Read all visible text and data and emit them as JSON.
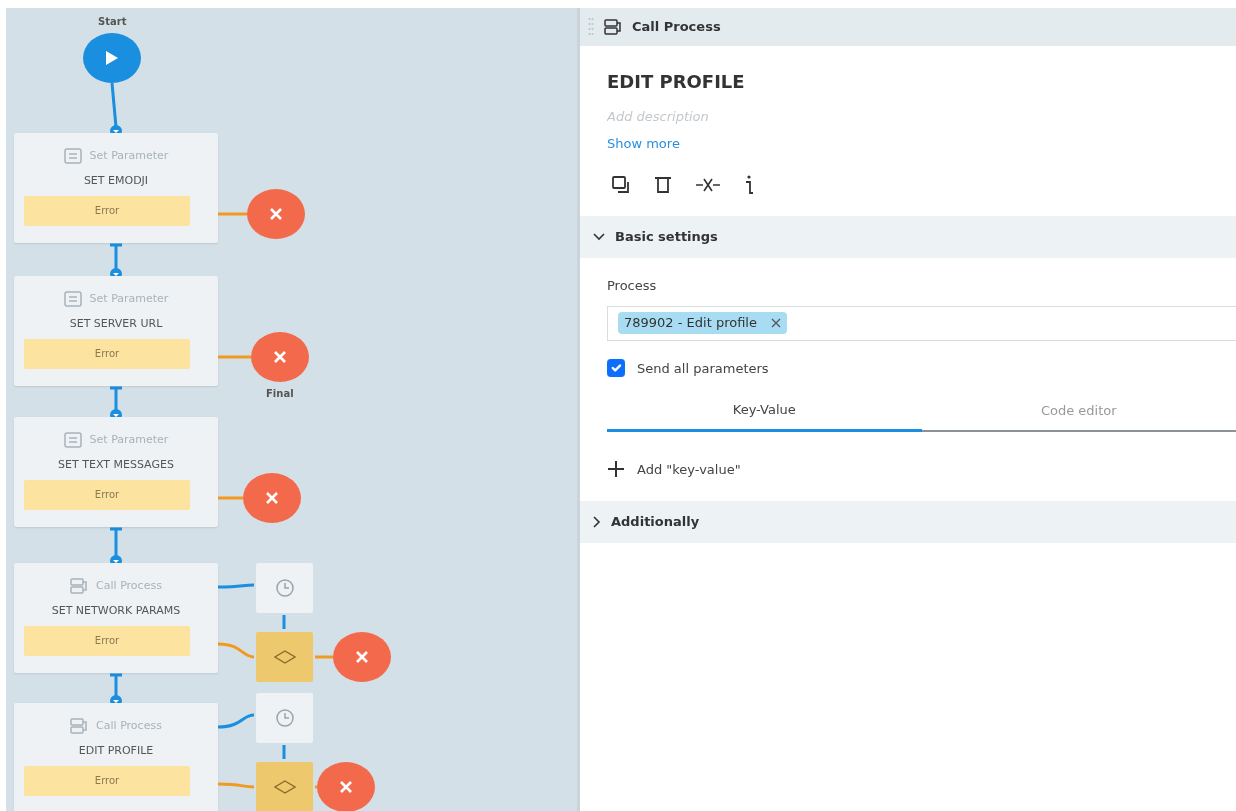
{
  "canvas": {
    "start": {
      "label": "Start"
    },
    "nodes": [
      {
        "kind": "set_parameter",
        "type": "Set Parameter",
        "title": "SET EMODJI",
        "error": "Error"
      },
      {
        "kind": "set_parameter",
        "type": "Set Parameter",
        "title": "SET SERVER URL",
        "error": "Error",
        "end_label": "Final"
      },
      {
        "kind": "set_parameter",
        "type": "Set Parameter",
        "title": "SET TEXT MESSAGES",
        "error": "Error"
      },
      {
        "kind": "call_process",
        "type": "Call Process",
        "title": "SET NETWORK PARAMS",
        "error": "Error"
      },
      {
        "kind": "call_process",
        "type": "Call Process",
        "title": "EDIT PROFILE",
        "error": "Error"
      }
    ]
  },
  "panel": {
    "header": {
      "title": "Call Process"
    },
    "name": "EDIT PROFILE",
    "description": {
      "placeholder": "Add description"
    },
    "show_more": "Show more",
    "sections": [
      {
        "title": "Basic settings",
        "expanded": true
      },
      {
        "title": "Additionally",
        "expanded": false
      }
    ],
    "process": {
      "label": "Process",
      "tags": [
        "789902 - Edit profile"
      ]
    },
    "send_all": {
      "label": "Send all parameters",
      "checked": true
    },
    "tabs": [
      {
        "label": "Key-Value",
        "selected": true
      },
      {
        "label": "Code editor",
        "selected": false
      }
    ],
    "add_button": "Add \"key-value\""
  }
}
